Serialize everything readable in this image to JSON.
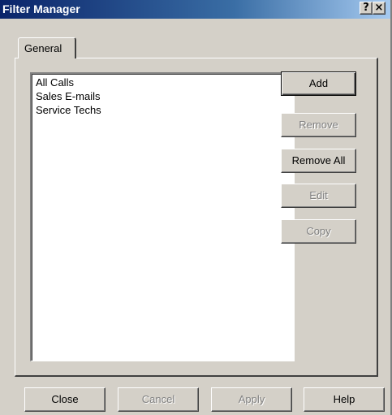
{
  "window": {
    "title": "Filter Manager",
    "help_button": "?",
    "close_button": "×"
  },
  "tabs": [
    {
      "label": "General",
      "active": true
    }
  ],
  "filter_list": {
    "items": [
      "All Calls",
      "Sales E-mails",
      "Service Techs"
    ]
  },
  "side_buttons": {
    "add": {
      "label": "Add",
      "enabled": true
    },
    "remove": {
      "label": "Remove",
      "enabled": false
    },
    "remove_all": {
      "label": "Remove All",
      "enabled": true
    },
    "edit": {
      "label": "Edit",
      "enabled": false
    },
    "copy": {
      "label": "Copy",
      "enabled": false
    }
  },
  "bottom_buttons": {
    "close": {
      "label": "Close",
      "enabled": true
    },
    "cancel": {
      "label": "Cancel",
      "enabled": false
    },
    "apply": {
      "label": "Apply",
      "enabled": false
    },
    "help": {
      "label": "Help",
      "enabled": true
    }
  },
  "colors": {
    "face": "#d4d0c8",
    "title_start": "#0a246a",
    "title_end": "#a6caf0",
    "disabled_text": "#808080"
  }
}
